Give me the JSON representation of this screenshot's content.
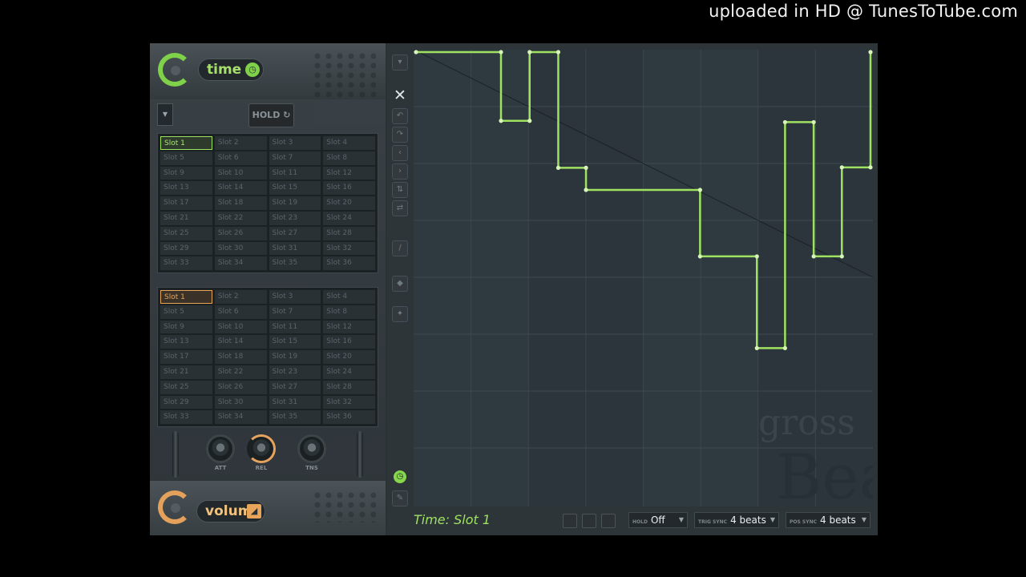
{
  "watermark": "uploaded in HD @ TunesToTube.com",
  "time_section": {
    "label": "time",
    "hold_label": "HOLD"
  },
  "time_slots": [
    "Slot 1",
    "Slot 2",
    "Slot 3",
    "Slot 4",
    "Slot 5",
    "Slot 6",
    "Slot 7",
    "Slot 8",
    "Slot 9",
    "Slot 10",
    "Slot 11",
    "Slot 12",
    "Slot 13",
    "Slot 14",
    "Slot 15",
    "Slot 16",
    "Slot 17",
    "Slot 18",
    "Slot 19",
    "Slot 20",
    "Slot 21",
    "Slot 22",
    "Slot 23",
    "Slot 24",
    "Slot 25",
    "Slot 26",
    "Slot 27",
    "Slot 28",
    "Slot 29",
    "Slot 30",
    "Slot 31",
    "Slot 32",
    "Slot 33",
    "Slot 34",
    "Slot 35",
    "Slot 36"
  ],
  "volume_slots": [
    "Slot 1",
    "Slot 2",
    "Slot 3",
    "Slot 4",
    "Slot 5",
    "Slot 6",
    "Slot 7",
    "Slot 8",
    "Slot 9",
    "Slot 10",
    "Slot 11",
    "Slot 12",
    "Slot 13",
    "Slot 14",
    "Slot 15",
    "Slot 16",
    "Slot 17",
    "Slot 18",
    "Slot 19",
    "Slot 20",
    "Slot 21",
    "Slot 22",
    "Slot 23",
    "Slot 24",
    "Slot 25",
    "Slot 26",
    "Slot 27",
    "Slot 28",
    "Slot 29",
    "Slot 30",
    "Slot 31",
    "Slot 32",
    "Slot 33",
    "Slot 34",
    "Slot 35",
    "Slot 36"
  ],
  "selected_time_slot": "Slot 1",
  "selected_volume_slot": "Slot 1",
  "knobs": {
    "att": "ATT",
    "rel": "REL",
    "tns": "TNS"
  },
  "volume_section": {
    "label": "volume"
  },
  "graph": {
    "title": "Time: Slot 1",
    "brand_line1": "gross",
    "brand_line2": "Beat",
    "envelope_color": "#9fe262",
    "envelope_points": [
      [
        0,
        1
      ],
      [
        0.187,
        1
      ],
      [
        0.187,
        0.848
      ],
      [
        0.25,
        0.848
      ],
      [
        0.25,
        1
      ],
      [
        0.313,
        1
      ],
      [
        0.313,
        0.744
      ],
      [
        0.374,
        0.744
      ],
      [
        0.374,
        0.695
      ],
      [
        0.625,
        0.695
      ],
      [
        0.625,
        0.548
      ],
      [
        0.75,
        0.548
      ],
      [
        0.75,
        0.345
      ],
      [
        0.812,
        0.345
      ],
      [
        0.812,
        0.845
      ],
      [
        0.875,
        0.845
      ],
      [
        0.875,
        0.548
      ],
      [
        0.937,
        0.548
      ],
      [
        0.937,
        0.745
      ],
      [
        1,
        0.745
      ],
      [
        1,
        1
      ]
    ]
  },
  "status_bar": {
    "hold_label": "HOLD",
    "hold_value": "Off",
    "trig_label": "TRIG SYNC",
    "trig_value": "4 beats",
    "pos_label": "POS SYNC",
    "pos_value": "4 beats"
  }
}
